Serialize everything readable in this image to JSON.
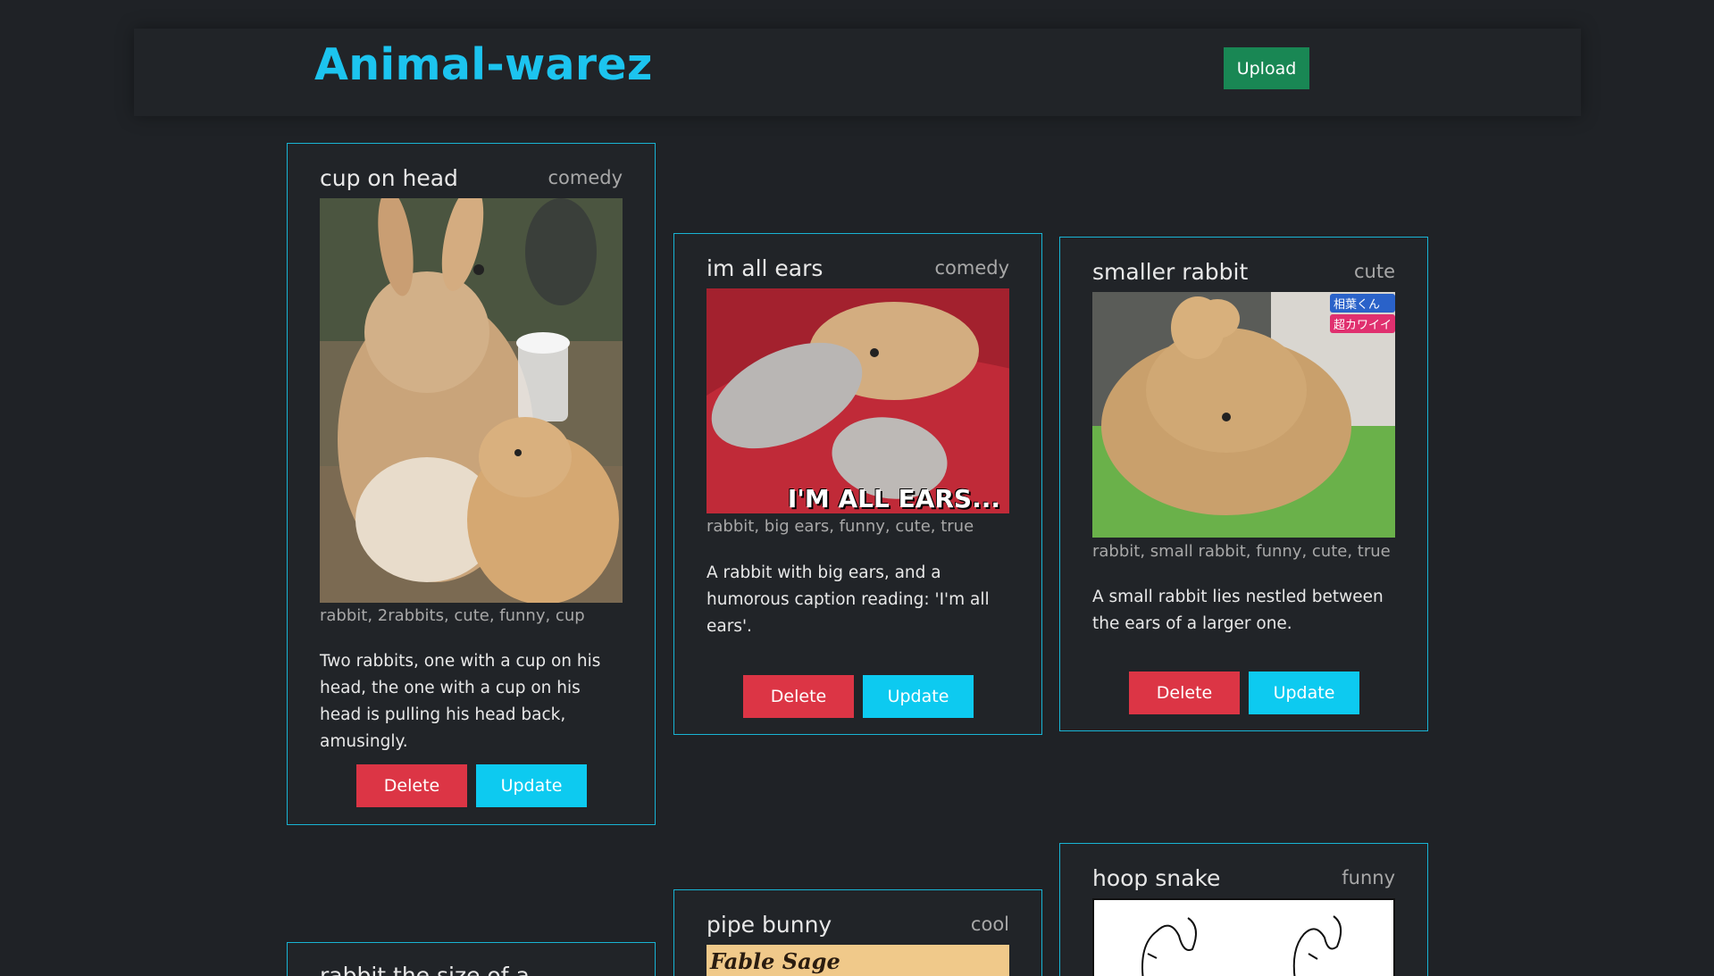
{
  "header": {
    "title": "Animal-warez",
    "upload_label": "Upload"
  },
  "colors": {
    "background": "#1f2226",
    "title": "#1cc4ef",
    "card_border": "#18b4d4",
    "upload": "#198754",
    "delete": "#dc3545",
    "update": "#0dcaf0"
  },
  "buttons": {
    "delete_label": "Delete",
    "update_label": "Update"
  },
  "cards": [
    {
      "title": "cup on head",
      "category": "comedy",
      "tags": "rabbit, 2rabbits, cute, funny, cup",
      "description": "Two rabbits, one with a cup on his head, the one with a cup on his head is pulling his head back, amusingly."
    },
    {
      "title": "im all ears",
      "category": "comedy",
      "tags": "rabbit, big ears, funny, cute, true",
      "description": "A rabbit with big ears, and a humorous caption reading: 'I'm all ears'.",
      "image_caption": "I'M ALL EARS..."
    },
    {
      "title": "smaller rabbit",
      "category": "cute",
      "tags": "rabbit, small rabbit, funny, cute, true",
      "description": "A small rabbit lies nestled between the ears of a larger one.",
      "image_badges": [
        "相葉くん",
        "超カワイイ"
      ]
    },
    {
      "title": "rabbit the size of a",
      "category": ""
    },
    {
      "title": "pipe bunny",
      "category": "cool",
      "image_caption": "Fable Sage"
    },
    {
      "title": "hoop snake",
      "category": "funny"
    }
  ]
}
